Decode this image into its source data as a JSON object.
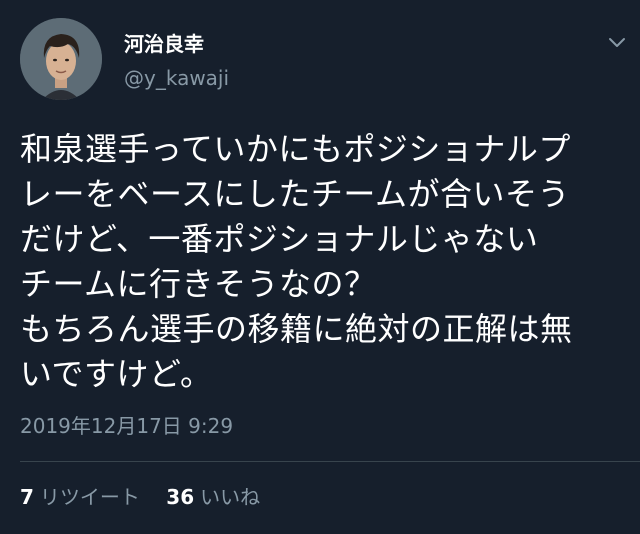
{
  "author": {
    "display_name": "河治良幸",
    "username": "@y_kawaji"
  },
  "tweet": {
    "lines": [
      "和泉選手っていかにもポジショナルプ",
      "レーをベースにしたチームが合いそう",
      "だけど、一番ポジショナルじゃない",
      "チームに行きそうなの？",
      "もちろん選手の移籍に絶対の正解は無",
      "いですけど。"
    ],
    "timestamp": "2019年12月17日 9:29"
  },
  "stats": {
    "retweets_count": "7",
    "retweets_label": "リツイート",
    "likes_count": "36",
    "likes_label": "いいね"
  },
  "icons": {
    "menu": "chevron-down-icon",
    "avatar": "user-avatar"
  },
  "colors": {
    "background": "#161f2c",
    "text_primary": "#ffffff",
    "text_secondary": "#8899a6",
    "divider": "#38444d"
  }
}
